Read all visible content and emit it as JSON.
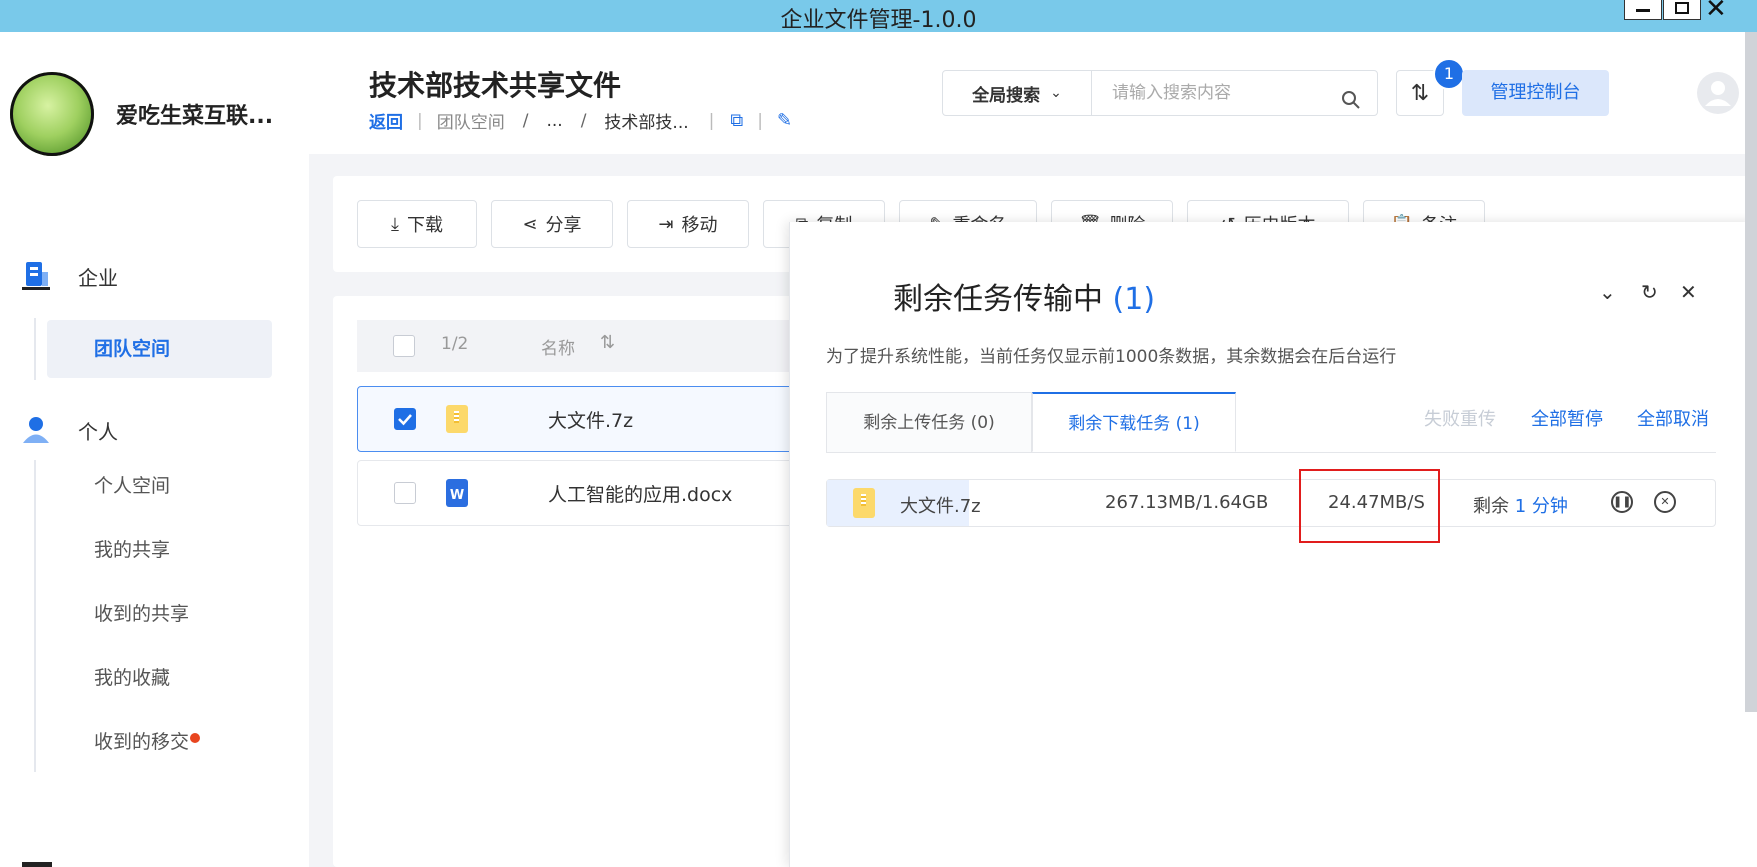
{
  "window": {
    "title": "企业文件管理-1.0.0"
  },
  "sidebar": {
    "company": "爱吃生菜互联...",
    "groups": [
      {
        "label": "企业",
        "icon": "building-icon"
      },
      {
        "label": "个人",
        "icon": "person-icon"
      }
    ],
    "enterprise_items": [
      {
        "label": "团队空间",
        "active": true
      }
    ],
    "personal_items": [
      {
        "label": "个人空间"
      },
      {
        "label": "我的共享"
      },
      {
        "label": "收到的共享"
      },
      {
        "label": "我的收藏"
      },
      {
        "label": "收到的移交",
        "has_dot": true
      }
    ]
  },
  "header": {
    "title": "技术部技术共享文件",
    "breadcrumb": {
      "back": "返回",
      "items": [
        "团队空间",
        "...",
        "技术部技..."
      ]
    },
    "search_scope": "全局搜索",
    "search_placeholder": "请输入搜索内容",
    "transfer_badge": "1",
    "admin_button": "管理控制台"
  },
  "toolbar": {
    "buttons": [
      {
        "label": "下载",
        "icon": "download-icon"
      },
      {
        "label": "分享",
        "icon": "share-icon"
      },
      {
        "label": "移动",
        "icon": "move-icon"
      },
      {
        "label": "复制",
        "icon": "copy-icon"
      },
      {
        "label": "重命名",
        "icon": "rename-icon"
      },
      {
        "label": "删除",
        "icon": "delete-icon"
      },
      {
        "label": "历史版本",
        "icon": "history-icon"
      },
      {
        "label": "备注",
        "icon": "note-icon"
      }
    ]
  },
  "filelist": {
    "header": {
      "count": "1/2",
      "name_col": "名称"
    },
    "rows": [
      {
        "name": "大文件.7z",
        "type": "zip",
        "selected": true
      },
      {
        "name": "人工智能的应用.docx",
        "type": "word",
        "selected": false
      }
    ]
  },
  "transfer_panel": {
    "title": "剩余任务传输中",
    "count": "(1)",
    "note": "为了提升系统性能，当前任务仅显示前1000条数据，其余数据会在后台运行",
    "tabs": [
      {
        "label": "剩余上传任务 (0)",
        "active": false
      },
      {
        "label": "剩余下载任务 (1)",
        "active": true
      }
    ],
    "actions": {
      "retry_failed": "失败重传",
      "pause_all": "全部暂停",
      "cancel_all": "全部取消"
    },
    "task": {
      "name": "大文件.7z",
      "size": "267.13MB/1.64GB",
      "progress": 0.16,
      "speed": "24.47MB/S",
      "remaining_label": "剩余",
      "remaining_value": "1 分钟"
    }
  },
  "colors": {
    "accent": "#1f6fe5",
    "titlebar": "#79c9ea",
    "highlight": "#e11d1d",
    "dot": "#e8451f"
  }
}
